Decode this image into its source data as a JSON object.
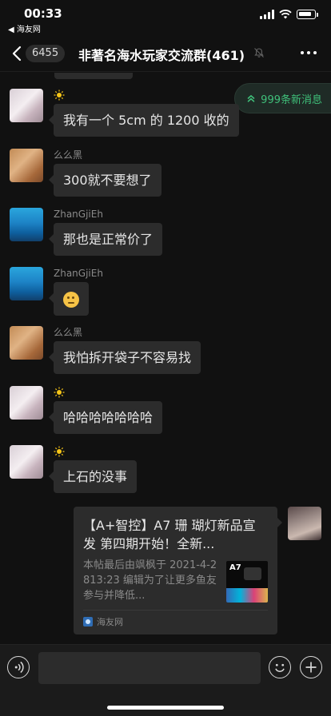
{
  "status_bar": {
    "time": "00:33",
    "back_app": "◀ 海友网"
  },
  "nav": {
    "unread_count": "6455",
    "title": "非著名海水玩家交流群(461)"
  },
  "new_messages": {
    "label": "999条新消息"
  },
  "messages": [
    {
      "sender": "",
      "text": "我有一个 5cm 的 1200 收的"
    },
    {
      "sender": "么么黑",
      "text": "300就不要想了"
    },
    {
      "sender": "ZhanGjiEh",
      "text": "那也是正常价了"
    },
    {
      "sender": "ZhanGjiEh",
      "text": ""
    },
    {
      "sender": "么么黑",
      "text": "我怕拆开袋子不容易找"
    },
    {
      "sender": "",
      "text": "哈哈哈哈哈哈哈"
    },
    {
      "sender": "",
      "text": "上石的没事"
    }
  ],
  "link_card": {
    "title": "【A+智控】A7 珊 瑚灯新品宣发  第四期开始！全新...",
    "description": "本帖最后由飒枫于 2021-4-2813:23 编辑为了让更多鱼友参与并降低...",
    "thumb_label": "A7",
    "source": "海友网"
  },
  "input": {
    "placeholder": ""
  }
}
